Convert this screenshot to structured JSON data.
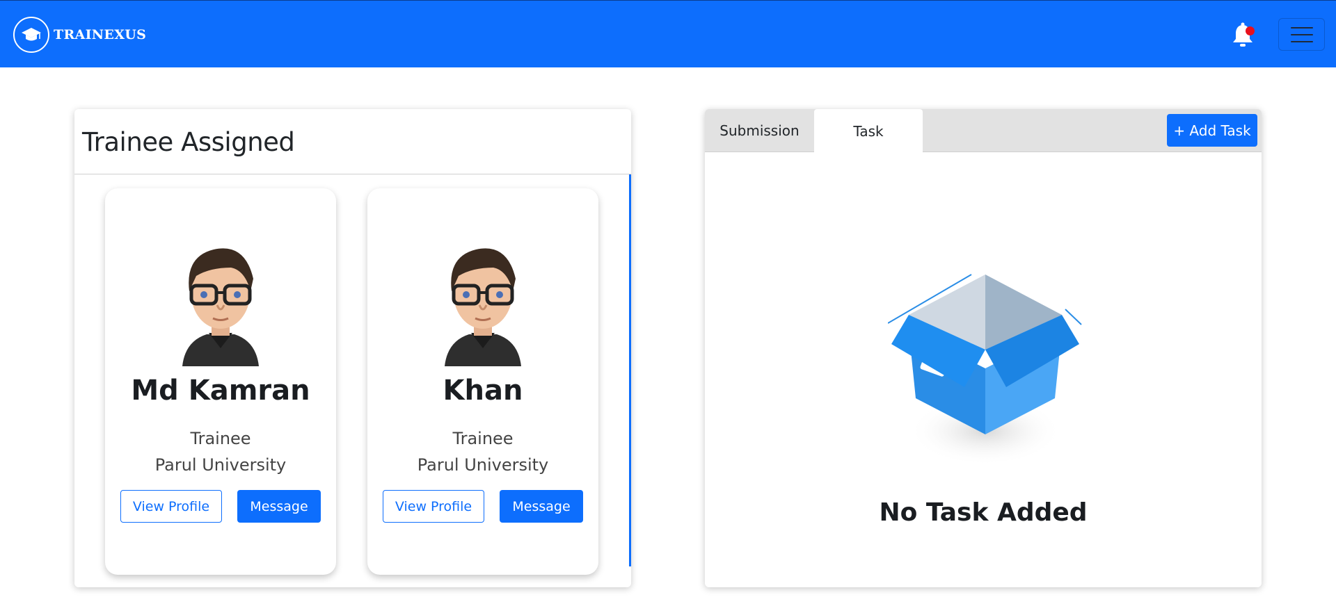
{
  "navbar": {
    "brand": "TRAINEXUS",
    "brand_icon": "graduation-cap-icon",
    "notification_icon": "bell-icon",
    "menu_icon": "hamburger-menu-icon",
    "bg_color": "#0d6efd"
  },
  "trainees_panel": {
    "title": "Trainee Assigned",
    "cards": [
      {
        "name": "Md Kamran",
        "role": "Trainee",
        "university": "Parul University",
        "view_label": "View Profile",
        "message_label": "Message"
      },
      {
        "name": "Khan",
        "role": "Trainee",
        "university": "Parul University",
        "view_label": "View Profile",
        "message_label": "Message"
      }
    ]
  },
  "tasks_panel": {
    "tabs": [
      {
        "label": "Submission",
        "active": false
      },
      {
        "label": "Task",
        "active": true
      }
    ],
    "add_button": "+ Add Task",
    "empty_icon": "empty-box-icon",
    "empty_message": "No Task Added"
  },
  "colors": {
    "primary": "#0d6efd",
    "notification_dot": "#e8101c"
  }
}
